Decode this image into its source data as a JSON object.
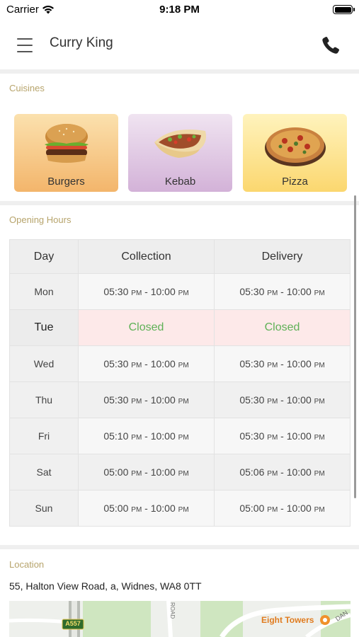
{
  "status_bar": {
    "carrier": "Carrier",
    "time": "9:18 PM"
  },
  "nav": {
    "title": "Curry King"
  },
  "cuisines": {
    "label": "Cuisines",
    "items": [
      {
        "name": "Burgers"
      },
      {
        "name": "Kebab"
      },
      {
        "name": "Pizza"
      }
    ]
  },
  "opening_hours": {
    "label": "Opening Hours",
    "headers": [
      "Day",
      "Collection",
      "Delivery"
    ],
    "rows": [
      {
        "day": "Mon",
        "collection": [
          "05:30",
          "PM",
          " - 10:00",
          "PM"
        ],
        "delivery": [
          "05:30",
          "PM",
          " - 10:00",
          "PM"
        ]
      },
      {
        "day": "Tue",
        "collection": "Closed",
        "delivery": "Closed"
      },
      {
        "day": "Wed",
        "collection": [
          "05:30",
          "PM",
          " - 10:00",
          "PM"
        ],
        "delivery": [
          "05:30",
          "PM",
          " - 10:00",
          "PM"
        ]
      },
      {
        "day": "Thu",
        "collection": [
          "05:30",
          "PM",
          " - 10:00",
          "PM"
        ],
        "delivery": [
          "05:30",
          "PM",
          " - 10:00",
          "PM"
        ]
      },
      {
        "day": "Fri",
        "collection": [
          "05:10",
          "PM",
          " - 10:00",
          "PM"
        ],
        "delivery": [
          "05:30",
          "PM",
          " - 10:00",
          "PM"
        ]
      },
      {
        "day": "Sat",
        "collection": [
          "05:00",
          "PM",
          " - 10:00",
          "PM"
        ],
        "delivery": [
          "05:06",
          "PM",
          " - 10:00",
          "PM"
        ]
      },
      {
        "day": "Sun",
        "collection": [
          "05:00",
          "PM",
          " - 10:00",
          "PM"
        ],
        "delivery": [
          "05:00",
          "PM",
          " - 10:00",
          "PM"
        ]
      }
    ]
  },
  "location": {
    "label": "Location",
    "address": "55, Halton View Road, a, Widnes, WA8 0TT",
    "map": {
      "road_badge": "A557",
      "poi": "Eight Towers",
      "street_partial": "ROAD",
      "street_partial_2": "DAN"
    }
  },
  "colors": {
    "section_label": "#b7a46c",
    "closed_text": "#5fb157",
    "closed_bg": "#fde9e9",
    "poi": "#e07b1e"
  },
  "icons": [
    "wifi-icon",
    "battery-icon",
    "hamburger-menu-icon",
    "phone-icon"
  ]
}
